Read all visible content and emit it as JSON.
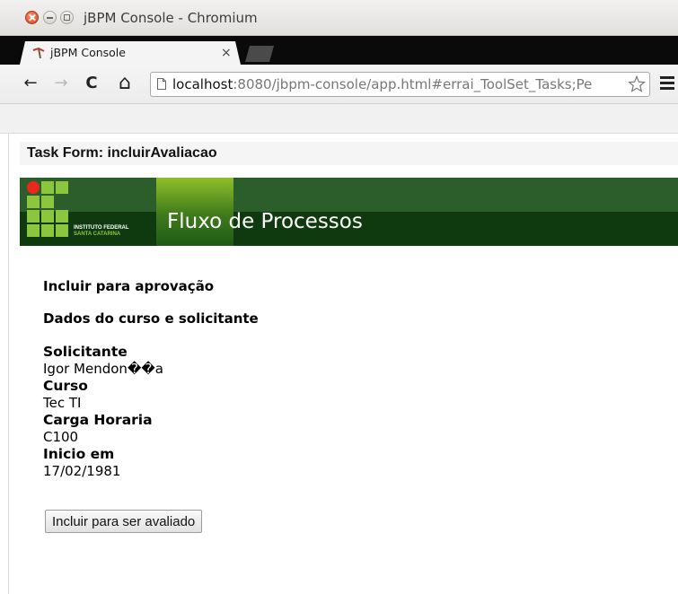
{
  "window": {
    "title": "jBPM Console - Chromium"
  },
  "tabs": [
    {
      "title": "jBPM Console",
      "close_glyph": "×"
    }
  ],
  "toolbar": {
    "back_glyph": "←",
    "forward_glyph": "→",
    "reload_glyph": "C",
    "home_glyph": "⌂",
    "url_host": "localhost",
    "url_rest": ":8080/jbpm-console/app.html#errai_ToolSet_Tasks;Pe"
  },
  "page": {
    "form_title": "Task Form: incluirAvaliacao",
    "banner": {
      "logo_line1": "INSTITUTO FEDERAL",
      "logo_line2": "SANTA CATARINA",
      "title": "Fluxo de Processos"
    },
    "heading1": "Incluir para aprovação",
    "heading2": "Dados do curso e solicitante",
    "fields": [
      {
        "label": "Solicitante",
        "value": "Igor Mendon��a"
      },
      {
        "label": "Curso",
        "value": "Tec TI"
      },
      {
        "label": "Carga Horaria",
        "value": "C100"
      },
      {
        "label": "Inicio em",
        "value": "17/02/1981"
      }
    ],
    "submit_label": "Incluir para ser avaliado"
  },
  "colors": {
    "banner_green": "#2b5e2b",
    "banner_dark": "#0f3a0f",
    "logo_green": "#8cc63f",
    "logo_red": "#e8281e"
  },
  "icons": [
    "close-window-icon",
    "minimize-window-icon",
    "maximize-window-icon",
    "tab-favicon-icon",
    "back-arrow-icon",
    "forward-arrow-icon",
    "reload-icon",
    "home-icon",
    "page-icon",
    "bookmark-star-icon",
    "menu-icon"
  ]
}
